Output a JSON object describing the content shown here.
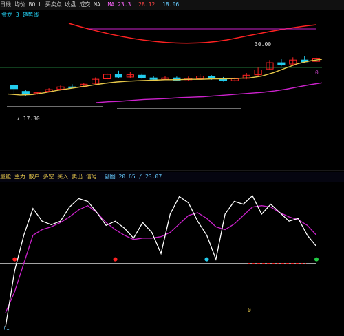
{
  "top_bar": {
    "left": "日线 均价 BOLL 买卖点 收盘 成交 MA",
    "ma_text": "MA 23.3",
    "right_a": "28.12",
    "right_b": "18.06"
  },
  "upper_legend": "金龙 3 趋势线",
  "upper_labels": {
    "price_hi": "30.00",
    "zero": "0",
    "low": "↓ 17.30"
  },
  "mid_bar": {
    "title": "量能 主力 散户 多空 买入 卖出 信号",
    "right": "副图 20.65 / 23.07"
  },
  "lower_labels": {
    "bottom_left": "+1",
    "mid_tick": "0"
  },
  "colors": {
    "bg": "#000000",
    "white_line": "#ffffff",
    "magenta_line": "#cc22cc",
    "red_line": "#ff2222",
    "green": "#22cc44",
    "yellow": "#e6c84a",
    "cyan": "#22ccee"
  },
  "chart_data": [
    {
      "type": "candlestick",
      "title": "",
      "series": [
        {
          "name": "",
          "values": [
            17.6,
            17.4,
            17.5,
            17.9,
            18.4,
            18.8,
            19.2,
            19.6,
            20.0,
            20.3,
            20.5,
            20.6,
            20.7,
            20.8,
            20.8,
            20.9,
            20.9,
            21.0,
            21.0,
            21.1,
            21.2,
            21.6,
            22.4,
            23.4,
            24.4,
            25.0,
            25.4
          ]
        },
        {
          "name": "",
          "values": [
            15.7,
            15.9,
            16.0,
            16.2,
            16.4,
            16.5,
            16.6,
            16.8,
            16.9,
            17.0,
            17.2,
            17.4,
            17.6,
            17.8,
            18.0,
            18.3,
            18.7,
            19.2,
            19.7,
            20.1
          ]
        }
      ],
      "candles": [
        {
          "o": 19.6,
          "c": 18.8,
          "h": 19.8,
          "l": 17.4
        },
        {
          "o": 18.2,
          "c": 17.5,
          "h": 18.6,
          "l": 17.2
        },
        {
          "o": 17.7,
          "c": 17.9,
          "h": 18.1,
          "l": 17.5
        },
        {
          "o": 18.2,
          "c": 18.6,
          "h": 18.9,
          "l": 18.0
        },
        {
          "o": 18.7,
          "c": 19.2,
          "h": 19.5,
          "l": 18.5
        },
        {
          "o": 19.2,
          "c": 19.0,
          "h": 19.8,
          "l": 18.9
        },
        {
          "o": 19.3,
          "c": 19.8,
          "h": 20.1,
          "l": 19.1
        },
        {
          "o": 20.0,
          "c": 20.9,
          "h": 21.3,
          "l": 19.8
        },
        {
          "o": 21.0,
          "c": 22.0,
          "h": 22.3,
          "l": 20.7
        },
        {
          "o": 22.0,
          "c": 21.4,
          "h": 22.8,
          "l": 21.2
        },
        {
          "o": 21.4,
          "c": 21.9,
          "h": 22.5,
          "l": 21.1
        },
        {
          "o": 21.8,
          "c": 21.2,
          "h": 22.2,
          "l": 21.0
        },
        {
          "o": 21.2,
          "c": 20.9,
          "h": 21.6,
          "l": 20.6
        },
        {
          "o": 20.9,
          "c": 21.2,
          "h": 21.6,
          "l": 20.8
        },
        {
          "o": 21.2,
          "c": 20.7,
          "h": 21.5,
          "l": 20.5
        },
        {
          "o": 20.8,
          "c": 21.1,
          "h": 21.5,
          "l": 20.6
        },
        {
          "o": 21.0,
          "c": 21.6,
          "h": 22.0,
          "l": 20.8
        },
        {
          "o": 21.5,
          "c": 21.0,
          "h": 21.8,
          "l": 20.8
        },
        {
          "o": 21.0,
          "c": 20.6,
          "h": 21.4,
          "l": 20.4
        },
        {
          "o": 20.6,
          "c": 21.0,
          "h": 21.3,
          "l": 20.4
        },
        {
          "o": 21.1,
          "c": 21.8,
          "h": 22.3,
          "l": 20.9
        },
        {
          "o": 21.9,
          "c": 23.0,
          "h": 23.5,
          "l": 21.7
        },
        {
          "o": 23.2,
          "c": 24.6,
          "h": 25.2,
          "l": 23.0
        },
        {
          "o": 24.6,
          "c": 24.1,
          "h": 25.4,
          "l": 23.8
        },
        {
          "o": 24.3,
          "c": 25.2,
          "h": 25.8,
          "l": 24.0
        },
        {
          "o": 25.2,
          "c": 24.8,
          "h": 26.0,
          "l": 24.5
        },
        {
          "o": 24.9,
          "c": 25.6,
          "h": 26.1,
          "l": 24.6
        }
      ],
      "ylim": [
        14,
        34
      ]
    },
    {
      "type": "line",
      "title": "",
      "series": [
        {
          "name": "",
          "values": [
            -90,
            -10,
            40,
            78,
            60,
            55,
            60,
            80,
            92,
            88,
            72,
            54,
            60,
            50,
            36,
            58,
            44,
            14,
            70,
            95,
            86,
            60,
            40,
            6,
            70,
            88,
            84,
            96,
            70,
            84,
            72,
            60,
            64,
            40,
            24
          ]
        },
        {
          "name": "",
          "values": [
            -70,
            -40,
            0,
            40,
            48,
            52,
            58,
            66,
            76,
            82,
            72,
            58,
            48,
            40,
            34,
            36,
            36,
            38,
            44,
            56,
            68,
            72,
            64,
            52,
            48,
            56,
            68,
            80,
            82,
            80,
            72,
            66,
            62,
            54,
            40
          ]
        }
      ],
      "ylim": [
        -100,
        110
      ]
    }
  ]
}
